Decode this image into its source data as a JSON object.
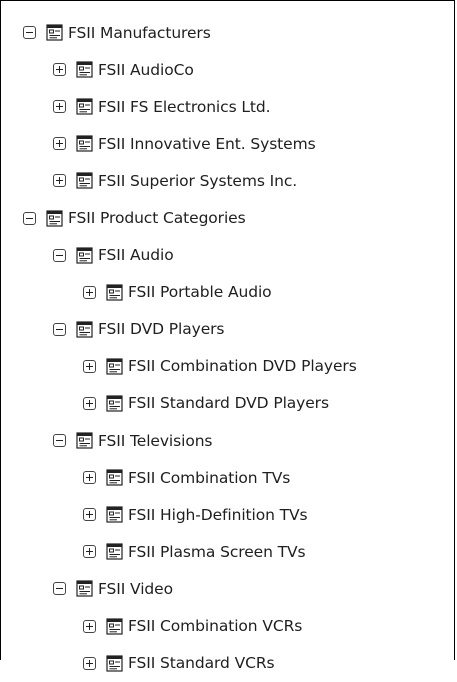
{
  "tree": {
    "nodes": [
      {
        "label": "FSII Manufacturers",
        "depth": 0,
        "state": "expanded",
        "icon": "category-folder-icon"
      },
      {
        "label": "FSII AudioCo",
        "depth": 1,
        "state": "collapsed",
        "icon": "category-folder-icon"
      },
      {
        "label": "FSII FS Electronics Ltd.",
        "depth": 1,
        "state": "collapsed",
        "icon": "category-folder-icon"
      },
      {
        "label": "FSII Innovative Ent. Systems",
        "depth": 1,
        "state": "collapsed",
        "icon": "category-folder-icon"
      },
      {
        "label": "FSII Superior Systems Inc.",
        "depth": 1,
        "state": "collapsed",
        "icon": "category-folder-icon"
      },
      {
        "label": "FSII Product Categories",
        "depth": 0,
        "state": "expanded",
        "icon": "category-folder-icon"
      },
      {
        "label": "FSII Audio",
        "depth": 1,
        "state": "expanded",
        "icon": "category-folder-icon"
      },
      {
        "label": "FSII Portable Audio",
        "depth": 2,
        "state": "collapsed",
        "icon": "category-folder-icon"
      },
      {
        "label": "FSII DVD Players",
        "depth": 1,
        "state": "expanded",
        "icon": "category-folder-icon"
      },
      {
        "label": "FSII Combination DVD Players",
        "depth": 2,
        "state": "collapsed",
        "icon": "category-folder-icon"
      },
      {
        "label": "FSII Standard DVD Players",
        "depth": 2,
        "state": "collapsed",
        "icon": "category-folder-icon"
      },
      {
        "label": "FSII Televisions",
        "depth": 1,
        "state": "expanded",
        "icon": "category-folder-icon"
      },
      {
        "label": "FSII Combination TVs",
        "depth": 2,
        "state": "collapsed",
        "icon": "category-folder-icon"
      },
      {
        "label": "FSII High-Definition TVs",
        "depth": 2,
        "state": "collapsed",
        "icon": "category-folder-icon"
      },
      {
        "label": "FSII Plasma Screen TVs",
        "depth": 2,
        "state": "collapsed",
        "icon": "category-folder-icon"
      },
      {
        "label": "FSII Video",
        "depth": 1,
        "state": "expanded",
        "icon": "category-folder-icon"
      },
      {
        "label": "FSII Combination VCRs",
        "depth": 2,
        "state": "collapsed",
        "icon": "category-folder-icon"
      },
      {
        "label": "FSII Standard VCRs",
        "depth": 2,
        "state": "collapsed",
        "icon": "category-folder-icon"
      }
    ]
  },
  "colors": {
    "border": "#000000",
    "text": "#1f1f1f",
    "icon_stroke": "#222222",
    "background": "#ffffff"
  }
}
